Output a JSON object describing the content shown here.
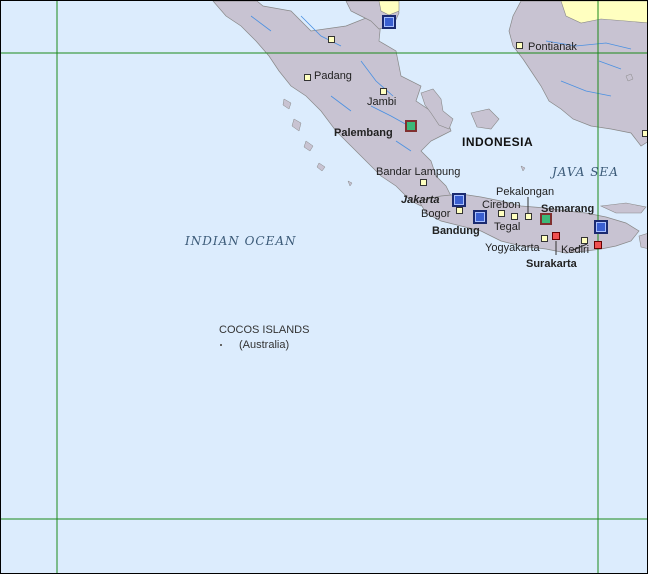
{
  "map": {
    "country": "INDONESIA",
    "seas": {
      "java_sea": "JAVA SEA",
      "indian_ocean": "INDIAN OCEAN"
    },
    "island_group": {
      "name": "COCOS ISLANDS",
      "note": "(Australia)"
    },
    "cities": {
      "pontianak": "Pontianak",
      "padang": "Padang",
      "jambi": "Jambi",
      "palembang": "Palembang",
      "bandar_lampung": "Bandar Lampung",
      "pekalongan": "Pekalongan",
      "cirebon": "Cirebon",
      "semarang": "Semarang",
      "jakarta": "Jakarta",
      "bogor": "Bogor",
      "tegal": "Tegal",
      "bandung": "Bandung",
      "yogyakarta": "Yogyakarta",
      "kediri": "Kediri",
      "surakarta": "Surakarta"
    },
    "colors": {
      "ocean": "#dcecfd",
      "land": "#c8c3d2",
      "neighbor_land": "#ffffc0",
      "gridline": "#1b8a1b",
      "river": "#4a90e2"
    }
  }
}
